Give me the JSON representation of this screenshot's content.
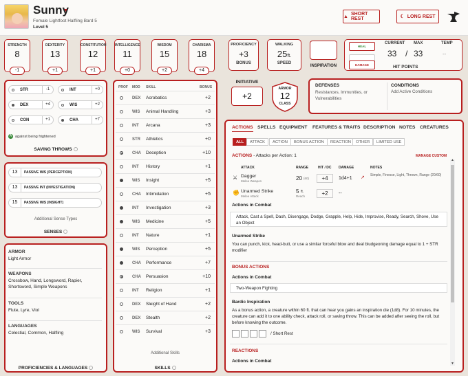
{
  "header": {
    "name": "Sunny",
    "description": "Female  Lightfoot Halfling  Bard 5",
    "level": "Level 5",
    "short_rest": "SHORT REST",
    "long_rest": "LONG REST"
  },
  "abilities": [
    {
      "label": "STRENGTH",
      "score": "8",
      "mod": "-1"
    },
    {
      "label": "DEXTERITY",
      "score": "13",
      "mod": "+1"
    },
    {
      "label": "CONSTITUTION",
      "score": "12",
      "mod": "+1"
    },
    {
      "label": "INTELLIGENCE",
      "score": "11",
      "mod": "+0"
    },
    {
      "label": "WISDOM",
      "score": "15",
      "mod": "+2"
    },
    {
      "label": "CHARISMA",
      "score": "18",
      "mod": "+4"
    }
  ],
  "proficiency": {
    "label": "PROFICIENCY",
    "value": "+3",
    "sub": "BONUS"
  },
  "walking": {
    "label": "WALKING",
    "value": "25",
    "unit": "ft.",
    "sub": "SPEED"
  },
  "inspiration": {
    "label": "INSPIRATION"
  },
  "hp": {
    "heal": "HEAL",
    "damage": "DAMAGE",
    "current_label": "CURRENT",
    "max_label": "MAX",
    "temp_label": "TEMP",
    "current": "33",
    "sep": "/",
    "max": "33",
    "temp": "--",
    "title": "HIT POINTS"
  },
  "initiative": {
    "label": "INITIATIVE",
    "value": "+2"
  },
  "armor": {
    "label": "ARMOR",
    "value": "12",
    "sub": "CLASS"
  },
  "defenses": {
    "title": "DEFENSES",
    "text": "Resistances, Immunities, or Vulnerabilities"
  },
  "conditions": {
    "title": "CONDITIONS",
    "text": "Add Active Conditions"
  },
  "saving_throws": {
    "title": "SAVING THROWS",
    "rows": [
      {
        "name": "STR",
        "value": "-1",
        "prof": false
      },
      {
        "name": "INT",
        "value": "+0",
        "prof": false
      },
      {
        "name": "DEX",
        "value": "+4",
        "prof": true
      },
      {
        "name": "WIS",
        "value": "+2",
        "prof": false
      },
      {
        "name": "CON",
        "value": "+1",
        "prof": false
      },
      {
        "name": "CHA",
        "value": "+7",
        "prof": true
      }
    ],
    "note": "against being frightened"
  },
  "senses": {
    "title": "SENSES",
    "rows": [
      {
        "value": "13",
        "label": "PASSIVE WIS (PERCEPTION)"
      },
      {
        "value": "13",
        "label": "PASSIVE INT (INVESTIGATION)"
      },
      {
        "value": "15",
        "label": "PASSIVE WIS (INSIGHT)"
      }
    ],
    "additional": "Additional Sense Types"
  },
  "proficiencies": {
    "title": "PROFICIENCIES & LANGUAGES",
    "groups": [
      {
        "head": "ARMOR",
        "text": "Light Armor"
      },
      {
        "head": "WEAPONS",
        "text": "Crossbow, Hand, Longsword, Rapier, Shortsword, Simple Weapons"
      },
      {
        "head": "TOOLS",
        "text": "Flute, Lyre, Viol"
      },
      {
        "head": "LANGUAGES",
        "text": "Celestial, Common, Halfling"
      }
    ]
  },
  "skills": {
    "title": "SKILLS",
    "col_prof": "PROF",
    "col_mod": "MOD",
    "col_skill": "SKILL",
    "col_bonus": "BONUS",
    "additional": "Additional Skills",
    "rows": [
      {
        "mod": "DEX",
        "name": "Acrobatics",
        "bonus": "+2",
        "prof": "half"
      },
      {
        "mod": "WIS",
        "name": "Animal Handling",
        "bonus": "+3",
        "prof": "half"
      },
      {
        "mod": "INT",
        "name": "Arcana",
        "bonus": "+3",
        "prof": "half"
      },
      {
        "mod": "STR",
        "name": "Athletics",
        "bonus": "+0",
        "prof": "half"
      },
      {
        "mod": "CHA",
        "name": "Deception",
        "bonus": "+10",
        "prof": "expert"
      },
      {
        "mod": "INT",
        "name": "History",
        "bonus": "+1",
        "prof": "half"
      },
      {
        "mod": "WIS",
        "name": "Insight",
        "bonus": "+5",
        "prof": "prof"
      },
      {
        "mod": "CHA",
        "name": "Intimidation",
        "bonus": "+5",
        "prof": "half"
      },
      {
        "mod": "INT",
        "name": "Investigation",
        "bonus": "+3",
        "prof": "prof"
      },
      {
        "mod": "WIS",
        "name": "Medicine",
        "bonus": "+5",
        "prof": "prof"
      },
      {
        "mod": "INT",
        "name": "Nature",
        "bonus": "+1",
        "prof": "half"
      },
      {
        "mod": "WIS",
        "name": "Perception",
        "bonus": "+5",
        "prof": "prof"
      },
      {
        "mod": "CHA",
        "name": "Performance",
        "bonus": "+7",
        "prof": "prof"
      },
      {
        "mod": "CHA",
        "name": "Persuasion",
        "bonus": "+10",
        "prof": "expert"
      },
      {
        "mod": "INT",
        "name": "Religion",
        "bonus": "+1",
        "prof": "half"
      },
      {
        "mod": "DEX",
        "name": "Sleight of Hand",
        "bonus": "+2",
        "prof": "half"
      },
      {
        "mod": "DEX",
        "name": "Stealth",
        "bonus": "+2",
        "prof": "half"
      },
      {
        "mod": "WIS",
        "name": "Survival",
        "bonus": "+3",
        "prof": "half"
      }
    ]
  },
  "actions": {
    "tabs": [
      "ACTIONS",
      "SPELLS",
      "EQUIPMENT",
      "FEATURES & TRAITS",
      "DESCRIPTION",
      "NOTES",
      "CREATURES"
    ],
    "filters": [
      "ALL",
      "ATTACK",
      "ACTION",
      "BONUS ACTION",
      "REACTION",
      "OTHER",
      "LIMITED USE"
    ],
    "section_title": "ACTIONS",
    "attacks_per_action": "- Attacks per Action: 1",
    "manage_custom": "MANAGE CUSTOM",
    "cols": {
      "attack": "ATTACK",
      "range": "RANGE",
      "hit": "HIT / DC",
      "damage": "DAMAGE",
      "notes": "NOTES"
    },
    "attacks": [
      {
        "name": "Dagger",
        "type": "Melee Weapon",
        "range": "20",
        "range_sub": "(60)",
        "hit": "+4",
        "damage": "1d4+1",
        "notes": "Simple, Finesse, Light, Thrown, Range (20/60)"
      },
      {
        "name": "Unarmed Strike",
        "type": "Melee Attack",
        "range": "5",
        "range_unit": "ft.",
        "range_sub": "Reach",
        "hit": "+2",
        "damage": "--",
        "notes": ""
      }
    ],
    "actions_in_combat": "Actions in Combat",
    "combat_list": "Attack, Cast a Spell, Dash, Disengage, Dodge, Grapple, Help, Hide, Improvise, Ready, Search, Shove, Use an Object",
    "unarmed_title": "Unarmed Strike",
    "unarmed_text": "You can punch, kick, head-butt, or use a similar forceful blow and deal bludgeoning damage equal to 1 + STR modifier",
    "bonus_title": "BONUS ACTIONS",
    "bonus_combat": "Actions in Combat",
    "two_weapon": "Two-Weapon Fighting",
    "bardic_title": "Bardic Inspiration",
    "bardic_text": "As a bonus action, a creature within 60 ft. that can hear you gains an inspiration die (1d8). For 10 minutes, the creature can add it to one ability check, attack roll, or saving throw. This can be added after seeing the roll, but before knowing the outcome.",
    "short_rest_label": "/ Short Rest",
    "reactions_title": "REACTIONS",
    "reactions_combat": "Actions in Combat"
  },
  "colors": {
    "accent": "#b81f1f",
    "background": "#eae4dc",
    "panel": "#fbfaf8"
  }
}
